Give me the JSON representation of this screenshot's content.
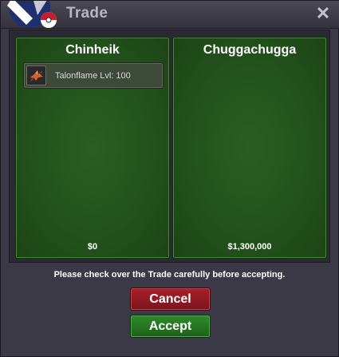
{
  "window": {
    "title": "Trade",
    "close_label": "✕"
  },
  "trade": {
    "left": {
      "name": "Chinheik",
      "items": [
        {
          "label": "Talonflame  Lvl: 100",
          "icon": "talonflame-icon"
        }
      ],
      "money": "$0"
    },
    "right": {
      "name": "Chuggachugga",
      "items": [],
      "money": "$1,300,000"
    },
    "notice": "Please check over the Trade carefully before accepting."
  },
  "buttons": {
    "cancel": "Cancel",
    "accept": "Accept"
  },
  "colors": {
    "panel_green": "#23521c",
    "cancel_red": "#a8202a",
    "accept_green": "#2f8a2a",
    "window_bg": "#3b3945"
  }
}
